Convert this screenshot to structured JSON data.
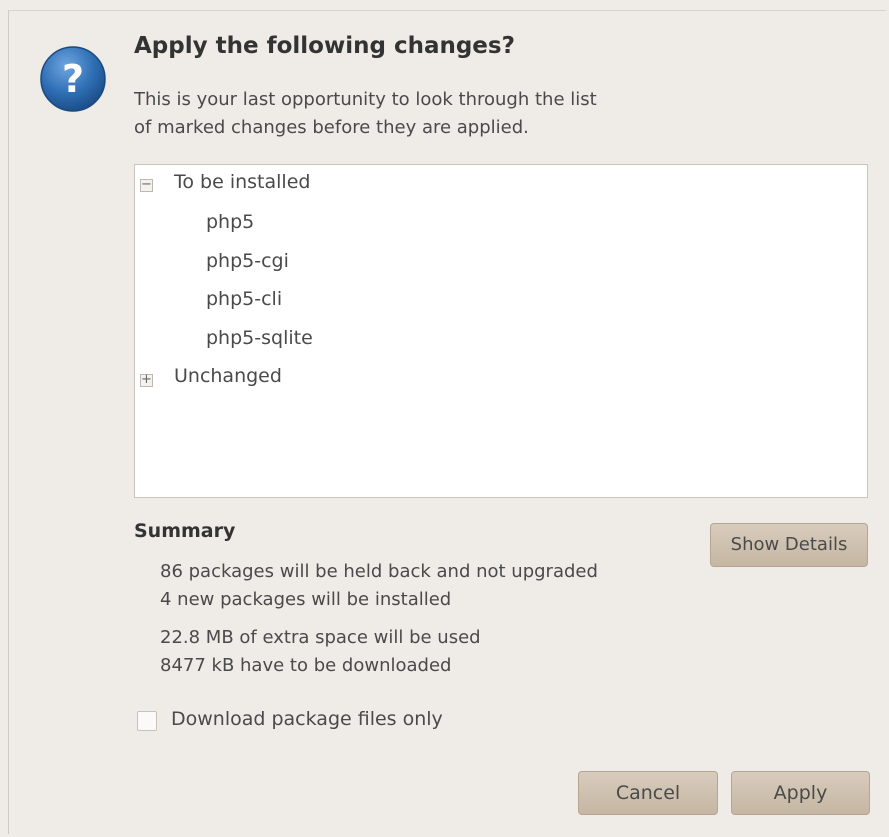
{
  "dialog": {
    "title": "Apply the following changes?",
    "intro_line1": "This is your last opportunity to look through the list",
    "intro_line2": "of marked changes before they are applied.",
    "icon": "question-icon"
  },
  "tree": {
    "groups": [
      {
        "label": "To be installed",
        "expanded": true,
        "expander": "−",
        "items": [
          "php5",
          "php5-cgi",
          "php5-cli",
          "php5-sqlite"
        ]
      },
      {
        "label": "Unchanged",
        "expanded": false,
        "expander": "+",
        "items": []
      }
    ]
  },
  "summary": {
    "title": "Summary",
    "lines": [
      "86 packages will be held back and not upgraded",
      "4 new packages will be installed",
      "22.8 MB of extra space will be used",
      "8477 kB have to be downloaded"
    ],
    "show_details_label": "Show Details"
  },
  "options": {
    "download_only_label": "Download package files only",
    "download_only_checked": false
  },
  "buttons": {
    "cancel_label": "Cancel",
    "apply_label": "Apply"
  },
  "colors": {
    "accent_blue": "#2f6fb5",
    "button_bg": "#cdbfae"
  }
}
